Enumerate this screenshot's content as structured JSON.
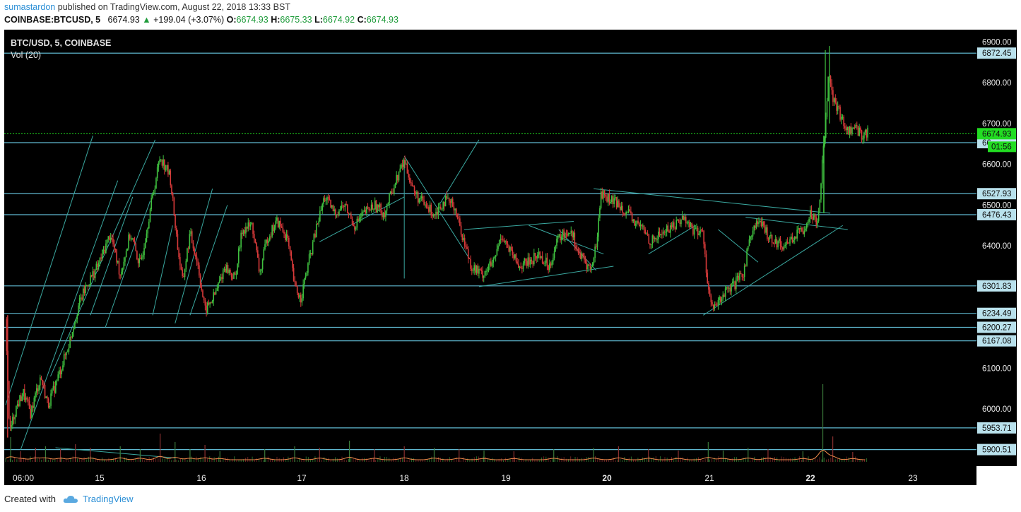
{
  "header": {
    "author": "sumastardon",
    "published_text": "published on TradingView.com, August 22, 2018 13:33 BST",
    "symbol": "COINBASE:BTCUSD, 5",
    "last": "6674.93",
    "change": "+199.04 (+3.07%)",
    "o_label": "O:",
    "o": "6674.93",
    "h_label": "H:",
    "h": "6675.33",
    "l_label": "L:",
    "l": "6674.92",
    "c_label": "C:",
    "c": "6674.93"
  },
  "legend": {
    "pair": "BTC/USD, 5, COINBASE",
    "volume": "Vol (20)"
  },
  "footer": {
    "created_with": "Created with",
    "brand": "TradingView"
  },
  "colors": {
    "background": "#000000",
    "up": "#3fbf3f",
    "down": "#d83a3a",
    "horizontal_line": "#5fb8d0",
    "trendline": "#3aa8a0",
    "current_price": "#22dd22",
    "volume_ma": "#f08a4b"
  },
  "chart_data": {
    "type": "candlestick",
    "title": "BTC/USD, 5, COINBASE",
    "x_ticks": [
      "06:00",
      "15",
      "16",
      "17",
      "18",
      "19",
      "20",
      "21",
      "22",
      "23"
    ],
    "y_ticks": [
      6000.0,
      6100.0,
      6200.0,
      6300.0,
      6400.0,
      6500.0,
      6600.0,
      6700.0,
      6800.0,
      6900.0
    ],
    "ylim": [
      5860,
      6930
    ],
    "horizontal_levels": [
      {
        "value": 6872.45,
        "label": "6872.45"
      },
      {
        "value": 6653.0,
        "label": "66"
      },
      {
        "value": 6527.93,
        "label": "6527.93"
      },
      {
        "value": 6476.43,
        "label": "6476.43"
      },
      {
        "value": 6301.83,
        "label": "6301.83"
      },
      {
        "value": 6234.49,
        "label": "6234.49"
      },
      {
        "value": 6200.27,
        "label": "6200.27"
      },
      {
        "value": 6167.08,
        "label": "6167.08"
      },
      {
        "value": 5953.71,
        "label": "5953.71"
      },
      {
        "value": 5900.51,
        "label": "5900.51"
      }
    ],
    "current_price": {
      "value": 6674.93,
      "label": "6674.93",
      "countdown": "01:56"
    },
    "price_path": [
      [
        0.0,
        6220
      ],
      [
        0.08,
        5940
      ],
      [
        0.2,
        6000
      ],
      [
        0.35,
        6040
      ],
      [
        0.5,
        5990
      ],
      [
        0.7,
        6080
      ],
      [
        0.85,
        6010
      ],
      [
        1.0,
        6060
      ],
      [
        1.25,
        6150
      ],
      [
        1.45,
        6250
      ],
      [
        1.65,
        6310
      ],
      [
        1.85,
        6350
      ],
      [
        2.1,
        6430
      ],
      [
        2.3,
        6330
      ],
      [
        2.5,
        6430
      ],
      [
        2.7,
        6350
      ],
      [
        2.9,
        6490
      ],
      [
        3.1,
        6620
      ],
      [
        3.3,
        6570
      ],
      [
        3.45,
        6400
      ],
      [
        3.55,
        6310
      ],
      [
        3.7,
        6430
      ],
      [
        3.85,
        6360
      ],
      [
        4.0,
        6240
      ],
      [
        4.2,
        6280
      ],
      [
        4.4,
        6350
      ],
      [
        4.6,
        6320
      ],
      [
        4.75,
        6440
      ],
      [
        4.95,
        6450
      ],
      [
        5.1,
        6330
      ],
      [
        5.25,
        6420
      ],
      [
        5.45,
        6460
      ],
      [
        5.65,
        6420
      ],
      [
        5.8,
        6300
      ],
      [
        5.92,
        6270
      ],
      [
        6.1,
        6370
      ],
      [
        6.25,
        6450
      ],
      [
        6.4,
        6520
      ],
      [
        6.6,
        6480
      ],
      [
        6.8,
        6500
      ],
      [
        7.0,
        6450
      ],
      [
        7.2,
        6480
      ],
      [
        7.4,
        6500
      ],
      [
        7.6,
        6480
      ],
      [
        7.8,
        6550
      ],
      [
        8.0,
        6610
      ],
      [
        8.2,
        6530
      ],
      [
        8.4,
        6500
      ],
      [
        8.6,
        6480
      ],
      [
        8.8,
        6510
      ],
      [
        9.0,
        6500
      ],
      [
        9.2,
        6410
      ],
      [
        9.35,
        6350
      ],
      [
        9.55,
        6330
      ],
      [
        9.8,
        6360
      ],
      [
        9.95,
        6430
      ],
      [
        10.1,
        6390
      ],
      [
        10.3,
        6350
      ],
      [
        10.5,
        6360
      ],
      [
        10.7,
        6380
      ],
      [
        10.9,
        6350
      ],
      [
        11.1,
        6420
      ],
      [
        11.35,
        6440
      ],
      [
        11.5,
        6380
      ],
      [
        11.75,
        6340
      ],
      [
        11.85,
        6400
      ],
      [
        11.95,
        6530
      ],
      [
        12.15,
        6510
      ],
      [
        12.35,
        6500
      ],
      [
        12.6,
        6460
      ],
      [
        12.8,
        6440
      ],
      [
        12.95,
        6410
      ],
      [
        13.15,
        6430
      ],
      [
        13.4,
        6450
      ],
      [
        13.6,
        6470
      ],
      [
        13.8,
        6440
      ],
      [
        14.0,
        6430
      ],
      [
        14.1,
        6290
      ],
      [
        14.2,
        6240
      ],
      [
        14.4,
        6280
      ],
      [
        14.6,
        6300
      ],
      [
        14.8,
        6330
      ],
      [
        14.95,
        6430
      ],
      [
        15.1,
        6460
      ],
      [
        15.35,
        6420
      ],
      [
        15.6,
        6400
      ],
      [
        15.8,
        6420
      ],
      [
        16.0,
        6440
      ],
      [
        16.15,
        6480
      ],
      [
        16.3,
        6460
      ],
      [
        16.35,
        6540
      ],
      [
        16.45,
        6700
      ],
      [
        16.52,
        6840
      ],
      [
        16.6,
        6760
      ],
      [
        16.75,
        6720
      ],
      [
        16.9,
        6680
      ],
      [
        17.05,
        6690
      ],
      [
        17.2,
        6670
      ],
      [
        17.3,
        6680
      ]
    ],
    "volume": {
      "ylim": [
        0,
        110
      ],
      "spikes": [
        [
          0.1,
          35
        ],
        [
          0.3,
          15
        ],
        [
          0.6,
          20
        ],
        [
          0.8,
          22
        ],
        [
          1.1,
          18
        ],
        [
          1.4,
          25
        ],
        [
          1.7,
          20
        ],
        [
          2.3,
          22
        ],
        [
          2.7,
          18
        ],
        [
          3.1,
          40
        ],
        [
          3.4,
          28
        ],
        [
          3.7,
          18
        ],
        [
          4.0,
          24
        ],
        [
          4.3,
          15
        ],
        [
          5.2,
          18
        ],
        [
          5.8,
          22
        ],
        [
          6.3,
          20
        ],
        [
          6.9,
          30
        ],
        [
          7.4,
          18
        ],
        [
          8.0,
          22
        ],
        [
          8.6,
          20
        ],
        [
          9.1,
          18
        ],
        [
          9.6,
          16
        ],
        [
          10.2,
          15
        ],
        [
          11.0,
          18
        ],
        [
          11.8,
          20
        ],
        [
          12.3,
          22
        ],
        [
          12.9,
          18
        ],
        [
          13.5,
          16
        ],
        [
          14.1,
          28
        ],
        [
          14.4,
          16
        ],
        [
          14.9,
          20
        ],
        [
          15.3,
          18
        ],
        [
          16.0,
          15
        ],
        [
          16.4,
          110
        ],
        [
          16.6,
          36
        ],
        [
          17.0,
          14
        ]
      ]
    }
  }
}
